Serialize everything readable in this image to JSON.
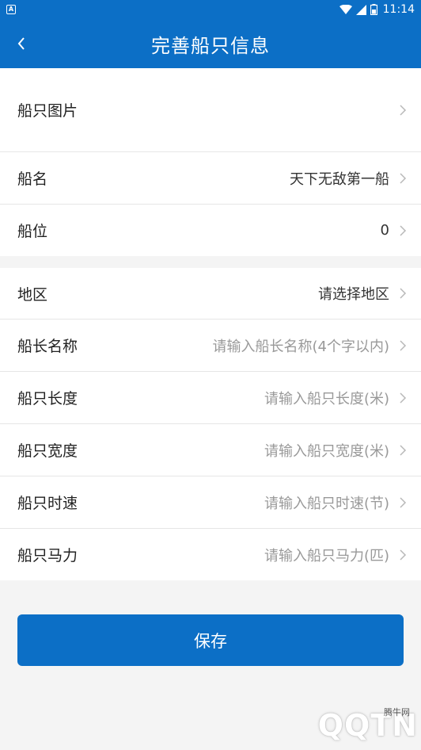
{
  "status_bar": {
    "time": "11:14"
  },
  "header": {
    "title": "完善船只信息"
  },
  "group1": [
    {
      "label": "船只图片",
      "value": ""
    }
  ],
  "group2": [
    {
      "label": "船名",
      "value": "天下无敌第一船"
    },
    {
      "label": "船位",
      "value": "0"
    }
  ],
  "group3": [
    {
      "label": "地区",
      "value": "请选择地区"
    },
    {
      "label": "船长名称",
      "placeholder": "请输入船长名称(4个字以内)"
    },
    {
      "label": "船只长度",
      "placeholder": "请输入船只长度(米)"
    },
    {
      "label": "船只宽度",
      "placeholder": "请输入船只宽度(米)"
    },
    {
      "label": "船只时速",
      "placeholder": "请输入船只时速(节)"
    },
    {
      "label": "船只马力",
      "placeholder": "请输入船只马力(匹)"
    }
  ],
  "save_label": "保存",
  "watermark": {
    "text": "QQTN",
    "sub": "腾牛网"
  },
  "colors": {
    "primary": "#0c6fc6",
    "background": "#f4f4f4",
    "placeholder": "#999999"
  }
}
